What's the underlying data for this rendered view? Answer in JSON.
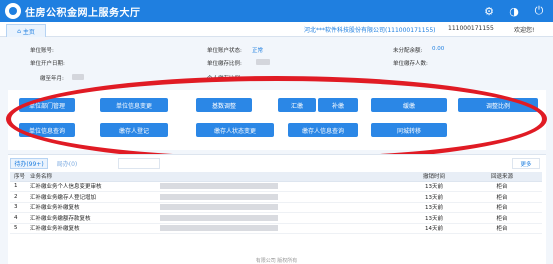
{
  "app": {
    "title": "住房公积金网上服务大厅"
  },
  "header": {
    "tab_home": "主页",
    "company_name": "河北***软件科技股份有限公司(111000171155)",
    "company_code": "111000171155",
    "welcome": "欢迎您!"
  },
  "info": {
    "unit_account_label": "单位账号:",
    "unit_status_label": "单位账户状态:",
    "unit_status_value": "正常",
    "unpaid_label": "未分配余额:",
    "unpaid_value": "0.00",
    "open_date_label": "单位开户日期:",
    "unit_ratio_label": "单位缴存比例:",
    "unit_members_label": "单位缴存人数:",
    "paid_month_label": "缴至年月:",
    "personal_ratio_label": "个人缴存比例:"
  },
  "operations": {
    "row1": [
      "单位部门管理",
      "单位信息变更",
      "基数调整",
      "汇缴",
      "补缴",
      "缓缴",
      "调整比例"
    ],
    "row2": [
      "单位信息查询",
      "缴存人登记",
      "缴存人状态变更",
      "缴存人信息查询",
      "同城转移"
    ]
  },
  "todo": {
    "tab_active": "待办(99+)",
    "tab_second": "局办(0)",
    "more": "更多",
    "columns": [
      "序号",
      "业务名称",
      "",
      "撤销时间",
      "回退来源"
    ],
    "rows": [
      {
        "no": "1",
        "name": "汇补缴业务个人信息变更审核",
        "time": "13天前",
        "source": "柜台"
      },
      {
        "no": "2",
        "name": "汇补缴业务缴存人登记增加",
        "time": "13天前",
        "source": "柜台"
      },
      {
        "no": "3",
        "name": "汇补缴业务补缴复核",
        "time": "13天前",
        "source": "柜台"
      },
      {
        "no": "4",
        "name": "汇补缴业务缴额存款复核",
        "time": "13天前",
        "source": "柜台"
      },
      {
        "no": "5",
        "name": "汇补缴业务补缴复核",
        "time": "14天前",
        "source": "柜台"
      }
    ]
  },
  "footer": {
    "text": "有限公司 版权所有"
  },
  "colors": {
    "brand": "#1f7fe0",
    "button": "#2b87e6",
    "annotation": "#e01b24"
  }
}
